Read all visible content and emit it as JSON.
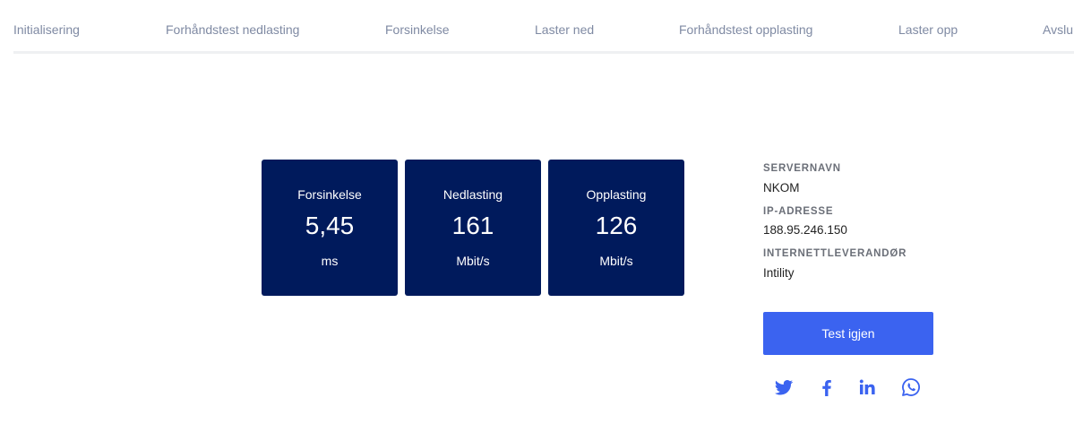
{
  "steps": [
    "Initialisering",
    "Forhåndstest nedlasting",
    "Forsinkelse",
    "Laster ned",
    "Forhåndstest opplasting",
    "Laster opp",
    "Avslu"
  ],
  "results": {
    "latency": {
      "label": "Forsinkelse",
      "value": "5,45",
      "unit": "ms"
    },
    "download": {
      "label": "Nedlasting",
      "value": "161",
      "unit": "Mbit/s"
    },
    "upload": {
      "label": "Opplasting",
      "value": "126",
      "unit": "Mbit/s"
    }
  },
  "info": {
    "server_label": "SERVERNAVN",
    "server_value": "NKOM",
    "ip_label": "IP-ADRESSE",
    "ip_value": "188.95.246.150",
    "isp_label": "INTERNETTLEVERANDØR",
    "isp_value": "Intility"
  },
  "actions": {
    "retry_label": "Test igjen"
  },
  "share_icons": [
    "twitter-icon",
    "facebook-icon",
    "linkedin-icon",
    "whatsapp-icon"
  ],
  "colors": {
    "card_bg": "#001a5c",
    "button_bg": "#3b63f0",
    "icon": "#3b63f0",
    "step_text": "#7f8aa3"
  }
}
